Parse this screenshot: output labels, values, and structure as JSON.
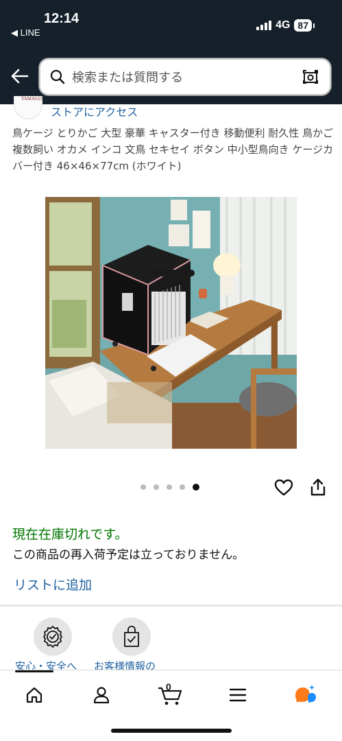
{
  "status_bar": {
    "time": "12:14",
    "back_app": "◀ LINE",
    "network": "4G",
    "battery": "87"
  },
  "search": {
    "placeholder": "検索または質問する"
  },
  "store": {
    "logo_text": "TAMAGO",
    "link_label": "ストアにアクセス"
  },
  "product": {
    "title": "鳥ケージ とりかご 大型 豪華 キャスター付き 移動便利 耐久性 鳥かご 複数飼い オカメ インコ 文鳥 セキセイ ボタン 中小型鳥向き ケージカバー付き 46×46×77cm (ホワイト)",
    "image_count": 5,
    "image_active_index": 4,
    "availability": "現在在庫切れです。",
    "restock_note": "この商品の再入荷予定は立っておりません。",
    "add_to_list": "リストに追加"
  },
  "assurance": {
    "items": [
      {
        "label": "安心・安全へ",
        "icon": "shield-check-icon"
      },
      {
        "label": "お客様情報の",
        "icon": "shopping-bag-check-icon"
      }
    ]
  },
  "bottom_nav": {
    "items": [
      {
        "name": "home",
        "icon": "home-icon"
      },
      {
        "name": "account",
        "icon": "person-icon"
      },
      {
        "name": "cart",
        "icon": "cart-icon",
        "count": "0"
      },
      {
        "name": "menu",
        "icon": "hamburger-icon"
      },
      {
        "name": "rufus",
        "icon": "rufus-icon"
      }
    ]
  },
  "colors": {
    "header_bg": "#15202b",
    "link": "#2162a1",
    "in_stock_green": "#007600",
    "rufus_orange": "#ff7a1a",
    "rufus_blue": "#1a8cff"
  }
}
